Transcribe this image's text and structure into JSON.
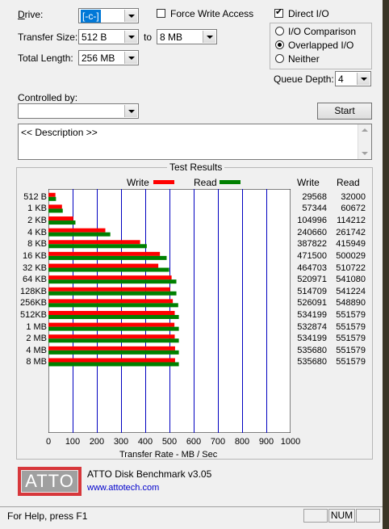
{
  "controls": {
    "drive_label": "Drive:",
    "drive_value": "[-c-]",
    "force_write_label": "Force Write Access",
    "force_write_checked": false,
    "direct_io_label": "Direct I/O",
    "direct_io_checked": true,
    "transfer_size_label": "Transfer Size:",
    "transfer_from": "512 B",
    "to_label": "to",
    "transfer_to": "8 MB",
    "total_length_label": "Total Length:",
    "total_length": "256 MB",
    "io_options": [
      {
        "label": "I/O Comparison",
        "selected": false
      },
      {
        "label": "Overlapped I/O",
        "selected": true
      },
      {
        "label": "Neither",
        "selected": false
      }
    ],
    "queue_depth_label": "Queue Depth:",
    "queue_depth": "4",
    "controlled_by_label": "Controlled by:",
    "controlled_by_value": "",
    "start_label": "Start",
    "description_text": "<< Description >>"
  },
  "results": {
    "group_title": "Test Results",
    "legend_write": "Write",
    "legend_read": "Read",
    "col_write": "Write",
    "col_read": "Read",
    "write_color": "#ff0000",
    "read_color": "#008000",
    "x_title": "Transfer Rate - MB / Sec"
  },
  "chart_data": {
    "type": "bar",
    "orientation": "horizontal",
    "categories": [
      "512 B",
      "1 KB",
      "2 KB",
      "4 KB",
      "8 KB",
      "16 KB",
      "32 KB",
      "64 KB",
      "128KB",
      "256KB",
      "512KB",
      "1 MB",
      "2 MB",
      "4 MB",
      "8 MB"
    ],
    "series": [
      {
        "name": "Write",
        "color": "#ff0000",
        "values": [
          29568,
          57344,
          104996,
          240660,
          387822,
          471500,
          464703,
          520971,
          514709,
          526091,
          534199,
          532874,
          534199,
          535680,
          535680
        ]
      },
      {
        "name": "Read",
        "color": "#008000",
        "values": [
          32000,
          60672,
          114212,
          261742,
          415949,
          500029,
          510722,
          541080,
          541224,
          548890,
          551579,
          551579,
          551579,
          551579,
          551579
        ]
      }
    ],
    "bar_units": "KB/s",
    "xlabel": "Transfer Rate - MB / Sec",
    "xlim": [
      0,
      1000
    ],
    "x_ticks": [
      0,
      100,
      200,
      300,
      400,
      500,
      600,
      700,
      800,
      900,
      1000
    ],
    "grid": true,
    "legend": "top"
  },
  "branding": {
    "logo_text": "ATTO",
    "product": "ATTO Disk Benchmark v3.05",
    "url": "www.attotech.com"
  },
  "statusbar": {
    "help_text": "For Help, press F1",
    "num": "NUM"
  }
}
